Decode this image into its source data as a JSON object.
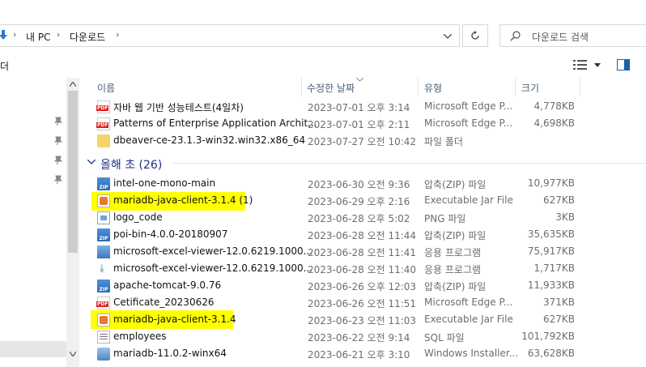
{
  "address": {
    "crumbs": [
      "내 PC",
      "다운로드"
    ],
    "search_placeholder": "다운로드 검색"
  },
  "toolbar": {
    "left_label": "더"
  },
  "columns": {
    "name": "이름",
    "date": "수정한 날짜",
    "type": "유형",
    "size": "크기"
  },
  "group": {
    "label": "올해 초 (26)"
  },
  "files_recent": [
    {
      "name": "자바 웹 기반 성능테스트(4일차)",
      "date": "2023-07-01 오후 3:14",
      "type": "Microsoft Edge P...",
      "size": "4,778KB",
      "icon": "pdf-icon"
    },
    {
      "name": "Patterns of Enterprise Application Archit...",
      "date": "2023-07-01 오후 2:11",
      "type": "Microsoft Edge P...",
      "size": "4,698KB",
      "icon": "pdf-icon"
    },
    {
      "name": "dbeaver-ce-23.1.3-win32.win32.x86_64",
      "date": "2023-07-27 오전 10:42",
      "type": "파일 폴더",
      "size": "",
      "icon": "folder-icon"
    }
  ],
  "files_group": [
    {
      "name": "intel-one-mono-main",
      "date": "2023-06-30 오전 9:36",
      "type": "압축(ZIP) 파일",
      "size": "10,977KB",
      "icon": "zip-icon"
    },
    {
      "name": "mariadb-java-client-3.1.4 (1)",
      "date": "2023-06-29 오후 2:16",
      "type": "Executable Jar File",
      "size": "627KB",
      "icon": "jar-icon"
    },
    {
      "name": "logo_code",
      "date": "2023-06-28 오후 5:02",
      "type": "PNG 파일",
      "size": "3KB",
      "icon": "png-icon"
    },
    {
      "name": "poi-bin-4.0.0-20180907",
      "date": "2023-06-28 오전 11:44",
      "type": "압축(ZIP) 파일",
      "size": "35,635KB",
      "icon": "zip-icon"
    },
    {
      "name": "microsoft-excel-viewer-12.0.6219.1000...",
      "date": "2023-06-28 오전 11:41",
      "type": "응용 프로그램",
      "size": "75,917KB",
      "icon": "installer-icon"
    },
    {
      "name": "microsoft-excel-viewer-12.0.6219.1000...",
      "date": "2023-06-28 오전 11:40",
      "type": "응용 프로그램",
      "size": "1,717KB",
      "icon": "download-icon"
    },
    {
      "name": "apache-tomcat-9.0.76",
      "date": "2023-06-26 오후 12:03",
      "type": "압축(ZIP) 파일",
      "size": "11,933KB",
      "icon": "zip-icon"
    },
    {
      "name": "Cetificate_20230626",
      "date": "2023-06-26 오전 11:51",
      "type": "Microsoft Edge P...",
      "size": "371KB",
      "icon": "pdf-icon"
    },
    {
      "name": "mariadb-java-client-3.1.4",
      "date": "2023-06-23 오전 11:03",
      "type": "Executable Jar File",
      "size": "627KB",
      "icon": "jar-icon"
    },
    {
      "name": "employees",
      "date": "2023-06-22 오전 9:14",
      "type": "SQL 파일",
      "size": "101,792KB",
      "icon": "sql-icon"
    },
    {
      "name": "mariadb-11.0.2-winx64",
      "date": "2023-06-21 오후 3:10",
      "type": "Windows Installer...",
      "size": "63,628KB",
      "icon": "msi-icon"
    }
  ],
  "colors": {
    "highlight": "#ffff00",
    "header_text": "#4c607a",
    "group_text": "#1e3287"
  }
}
